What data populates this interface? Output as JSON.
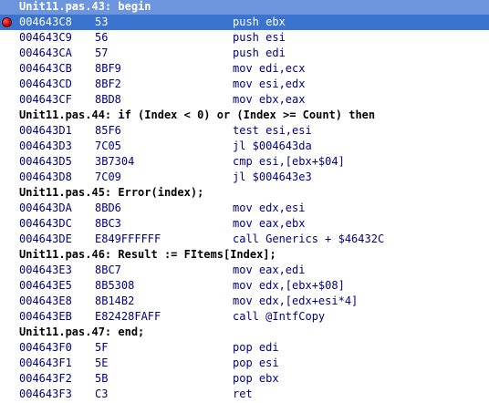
{
  "source_lines": [
    {
      "text": "Unit11.pas.43: begin",
      "row": 0
    },
    {
      "text": "Unit11.pas.44: if (Index < 0) or (Index >= Count) then",
      "row": 7
    },
    {
      "text": "Unit11.pas.45: Error(index);",
      "row": 12
    },
    {
      "text": "Unit11.pas.46: Result := FItems[Index];",
      "row": 16
    },
    {
      "text": "Unit11.pas.47: end;",
      "row": 21
    }
  ],
  "asm_lines": [
    {
      "row": 1,
      "addr": "004643C8",
      "bytes": "53",
      "instr": "push ebx",
      "breakpoint": true,
      "current": true
    },
    {
      "row": 2,
      "addr": "004643C9",
      "bytes": "56",
      "instr": "push esi"
    },
    {
      "row": 3,
      "addr": "004643CA",
      "bytes": "57",
      "instr": "push edi"
    },
    {
      "row": 4,
      "addr": "004643CB",
      "bytes": "8BF9",
      "instr": "mov edi,ecx"
    },
    {
      "row": 5,
      "addr": "004643CD",
      "bytes": "8BF2",
      "instr": "mov esi,edx"
    },
    {
      "row": 6,
      "addr": "004643CF",
      "bytes": "8BD8",
      "instr": "mov ebx,eax"
    },
    {
      "row": 8,
      "addr": "004643D1",
      "bytes": "85F6",
      "instr": "test esi,esi"
    },
    {
      "row": 9,
      "addr": "004643D3",
      "bytes": "7C05",
      "instr": "jl $004643da"
    },
    {
      "row": 10,
      "addr": "004643D5",
      "bytes": "3B7304",
      "instr": "cmp esi,[ebx+$04]"
    },
    {
      "row": 11,
      "addr": "004643D8",
      "bytes": "7C09",
      "instr": "jl $004643e3"
    },
    {
      "row": 13,
      "addr": "004643DA",
      "bytes": "8BD6",
      "instr": "mov edx,esi"
    },
    {
      "row": 14,
      "addr": "004643DC",
      "bytes": "8BC3",
      "instr": "mov eax,ebx"
    },
    {
      "row": 15,
      "addr": "004643DE",
      "bytes": "E849FFFFFF",
      "instr": "call Generics + $46432C"
    },
    {
      "row": 17,
      "addr": "004643E3",
      "bytes": "8BC7",
      "instr": "mov eax,edi"
    },
    {
      "row": 18,
      "addr": "004643E5",
      "bytes": "8B5308",
      "instr": "mov edx,[ebx+$08]"
    },
    {
      "row": 19,
      "addr": "004643E8",
      "bytes": "8B14B2",
      "instr": "mov edx,[edx+esi*4]"
    },
    {
      "row": 20,
      "addr": "004643EB",
      "bytes": "E82428FAFF",
      "instr": "call @IntfCopy"
    },
    {
      "row": 22,
      "addr": "004643F0",
      "bytes": "5F",
      "instr": "pop edi"
    },
    {
      "row": 23,
      "addr": "004643F1",
      "bytes": "5E",
      "instr": "pop esi"
    },
    {
      "row": 24,
      "addr": "004643F2",
      "bytes": "5B",
      "instr": "pop ebx"
    },
    {
      "row": 25,
      "addr": "004643F3",
      "bytes": "C3",
      "instr": "ret"
    }
  ],
  "colors": {
    "highlight": "#3b73d1",
    "asm_text": "#000080",
    "source_text": "#000000",
    "breakpoint": "#d00000"
  },
  "icons": {
    "breakpoint": "breakpoint-icon"
  }
}
